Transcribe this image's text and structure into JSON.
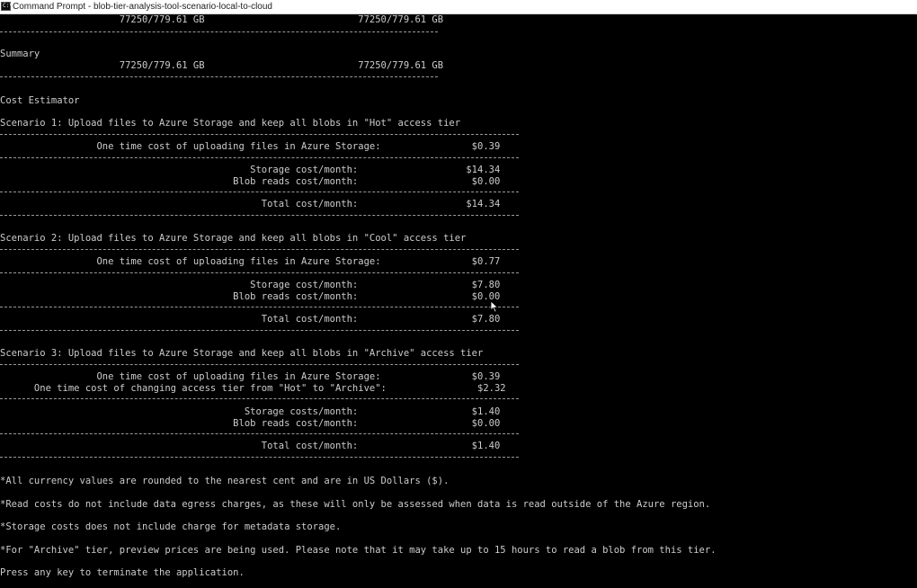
{
  "window": {
    "title": "Command Prompt - blob-tier-analysis-tool-scenario-local-to-cloud",
    "icon_label": "C:\\"
  },
  "console": {
    "lines": {
      "total_top": "                     77250/779.61 GB                           77250/779.61 GB",
      "summary_heading": "Summary",
      "summary_values": "                     77250/779.61 GB                           77250/779.61 GB",
      "cost_estimator": "Cost Estimator",
      "s1_title": "Scenario 1: Upload files to Azure Storage and keep all blobs in \"Hot\" access tier",
      "s1_upload": "                 One time cost of uploading files in Azure Storage:                $0.39",
      "s1_storage": "                                            Storage cost/month:                   $14.34",
      "s1_reads": "                                         Blob reads cost/month:                    $0.00",
      "s1_total": "                                              Total cost/month:                   $14.34",
      "s2_title": "Scenario 2: Upload files to Azure Storage and keep all blobs in \"Cool\" access tier",
      "s2_upload": "                 One time cost of uploading files in Azure Storage:                $0.77",
      "s2_storage": "                                            Storage cost/month:                    $7.80",
      "s2_reads": "                                         Blob reads cost/month:                    $0.00",
      "s2_total": "                                              Total cost/month:                    $7.80",
      "s3_title": "Scenario 3: Upload files to Azure Storage and keep all blobs in \"Archive\" access tier",
      "s3_upload": "                 One time cost of uploading files in Azure Storage:                $0.39",
      "s3_tier_change": "      One time cost of changing access tier from \"Hot\" to \"Archive\":                $2.32",
      "s3_storage": "                                           Storage costs/month:                    $1.40",
      "s3_reads": "                                         Blob reads cost/month:                    $0.00",
      "s3_total": "                                              Total cost/month:                    $1.40",
      "note_currency": "*All currency values are rounded to the nearest cent and are in US Dollars ($).",
      "note_read_costs": "*Read costs do not include data egress charges, as these will only be assessed when data is read outside of the Azure region.",
      "note_storage": "*Storage costs does not include charge for metadata storage.",
      "note_archive": "*For \"Archive\" tier, preview prices are being used. Please note that it may take up to 15 hours to read a blob from this tier.",
      "prompt": "Press any key to terminate the application."
    }
  },
  "colors": {
    "console_bg": "#000000",
    "console_text": "#cccccc",
    "titlebar_bg": "#ffffff"
  }
}
